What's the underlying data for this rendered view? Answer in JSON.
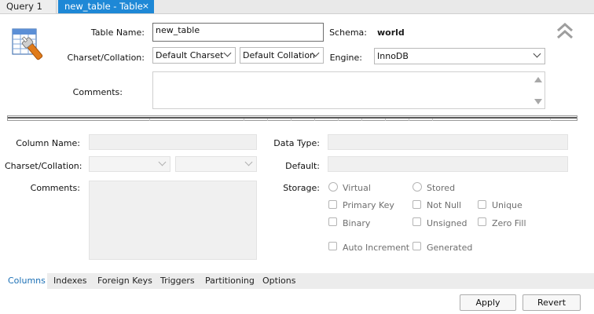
{
  "tabs": [
    {
      "label": "Query 1"
    },
    {
      "label": "new_table - Table",
      "close": "×"
    }
  ],
  "header": {
    "table_name_label": "Table Name:",
    "table_name_value": "new_table",
    "schema_label": "Schema:",
    "schema_value": "world",
    "charset_label": "Charset/Collation:",
    "charset_value": "Default Charset",
    "collation_value": "Default Collation",
    "engine_label": "Engine:",
    "engine_value": "InnoDB",
    "comments_label": "Comments:",
    "comments_value": ""
  },
  "column_details": {
    "column_name_label": "Column Name:",
    "charset_label": "Charset/Collation:",
    "comments_label": "Comments:",
    "data_type_label": "Data Type:",
    "default_label": "Default:",
    "storage_label": "Storage:",
    "storage_options": [
      "Virtual",
      "Stored"
    ],
    "flags": [
      "Primary Key",
      "Not Null",
      "Unique",
      "Binary",
      "Unsigned",
      "Zero Fill",
      "Auto Increment",
      "Generated"
    ]
  },
  "bottom_tabs": [
    "Columns",
    "Indexes",
    "Foreign Keys",
    "Triggers",
    "Partitioning",
    "Options"
  ],
  "buttons": {
    "apply": "Apply",
    "revert": "Revert"
  },
  "colors": {
    "active_tab": "#1e88d6",
    "active_bottom_tab_text": "#1a6fb5"
  }
}
